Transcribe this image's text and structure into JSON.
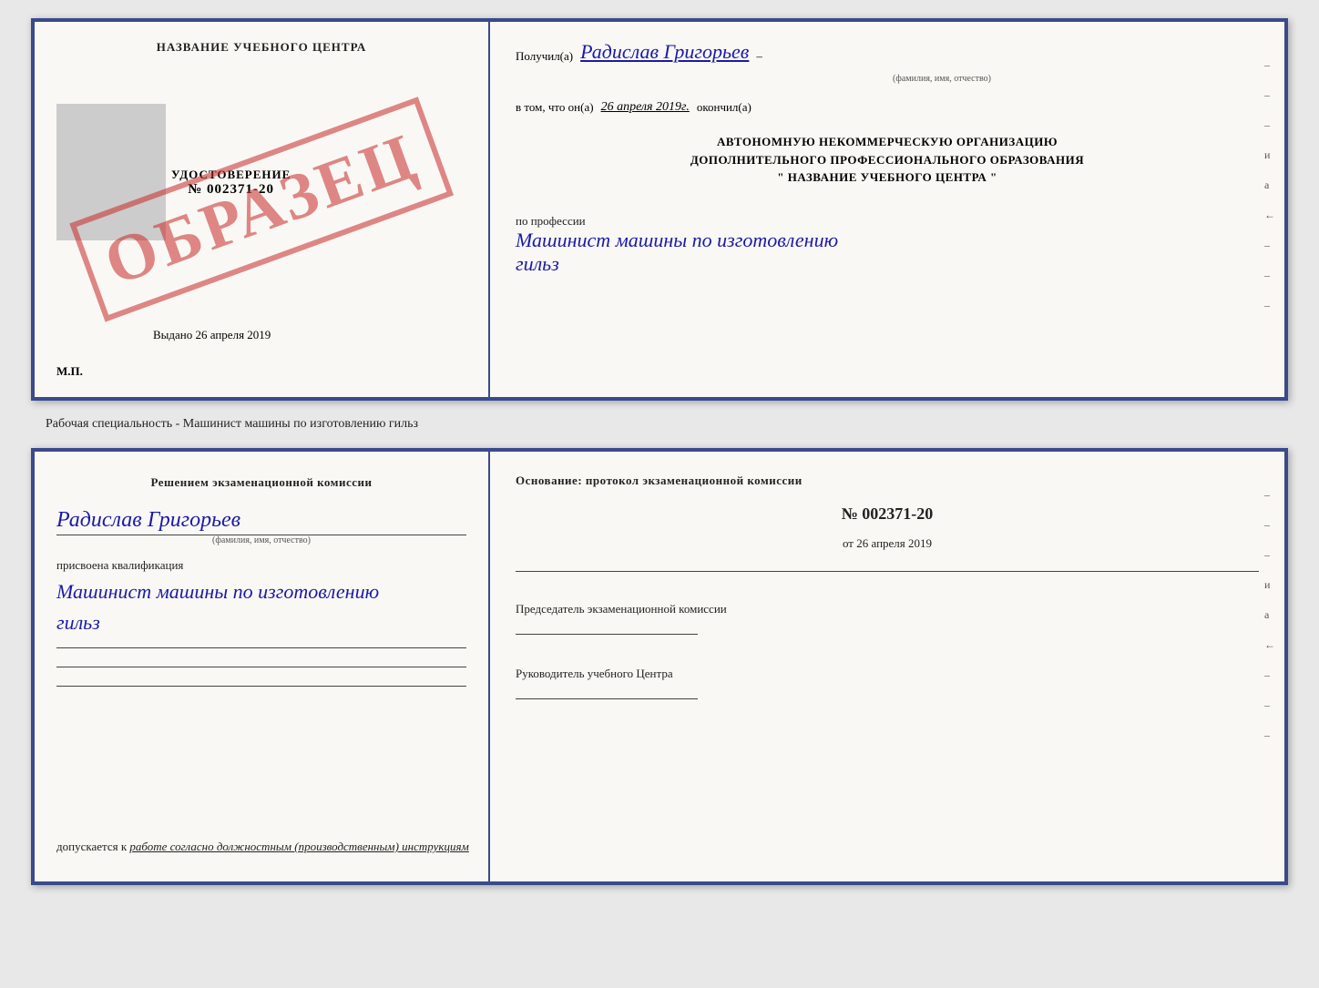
{
  "topDoc": {
    "left": {
      "title": "НАЗВАНИЕ УЧЕБНОГО ЦЕНТРА",
      "udostoverenie": "УДОСТОВЕРЕНИЕ",
      "number": "№ 002371-20",
      "vydano": "Выдано",
      "vydano_date": "26 апреля 2019",
      "mp": "М.П.",
      "stamp": "ОБРАЗЕЦ"
    },
    "right": {
      "poluchil_label": "Получил(а)",
      "recipient_name": "Радислав Григорьев",
      "fio_sub": "(фамилия, имя, отчество)",
      "dash": "–",
      "vtom_label": "в том, что он(а)",
      "date_handwritten": "26 апреля 2019г.",
      "okonchil": "окончил(а)",
      "org_line1": "АВТОНОМНУЮ НЕКОММЕРЧЕСКУЮ ОРГАНИЗАЦИЮ",
      "org_line2": "ДОПОЛНИТЕЛЬНОГО ПРОФЕССИОНАЛЬНОГО ОБРАЗОВАНИЯ",
      "org_name": "\"  НАЗВАНИЕ УЧЕБНОГО ЦЕНТРА  \"",
      "po_professii": "по профессии",
      "profession_line1": "Машинист машины по изготовлению",
      "profession_line2": "гильз",
      "side_marks": [
        "–",
        "–",
        "–",
        "и",
        "а",
        "←",
        "–",
        "–",
        "–"
      ]
    }
  },
  "separator": "Рабочая специальность - Машинист машины по изготовлению гильз",
  "bottomDoc": {
    "left": {
      "title": "Решением  экзаменационной  комиссии",
      "name": "Радислав Григорьев",
      "fio_sub": "(фамилия, имя, отчество)",
      "prisvoena": "присвоена квалификация",
      "profession_line1": "Машинист машины по изготовлению",
      "profession_line2": "гильз",
      "dopuskaetsya": "допускается к",
      "dopuskaetsya_hw": "работе согласно должностным (производственным) инструкциям"
    },
    "right": {
      "osnovanie": "Основание: протокол экзаменационной  комиссии",
      "protocol_num": "№  002371-20",
      "ot_label": "от",
      "ot_date": "26 апреля 2019",
      "predsedatel": "Председатель экзаменационной комиссии",
      "rukovoditel": "Руководитель учебного Центра",
      "side_marks": [
        "–",
        "–",
        "–",
        "и",
        "а",
        "←",
        "–",
        "–",
        "–"
      ]
    }
  }
}
